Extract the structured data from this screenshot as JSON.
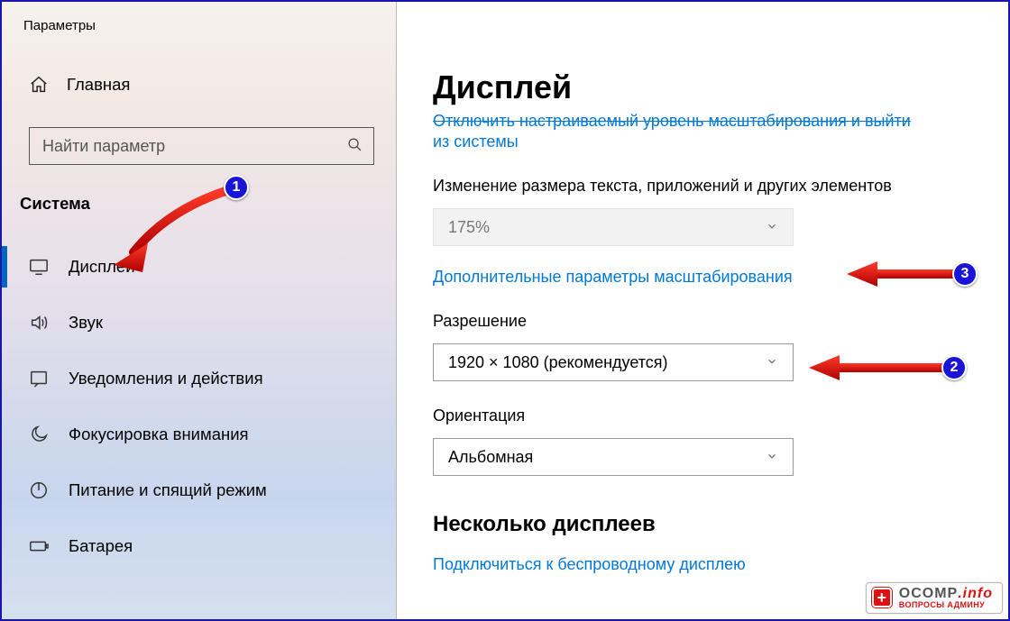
{
  "app_title": "Параметры",
  "home_label": "Главная",
  "search": {
    "placeholder": "Найти параметр"
  },
  "section": "Система",
  "nav": [
    {
      "id": "display",
      "label": "Дисплей",
      "icon": "monitor",
      "active": true
    },
    {
      "id": "sound",
      "label": "Звук",
      "icon": "sound",
      "active": false
    },
    {
      "id": "notifications",
      "label": "Уведомления и действия",
      "icon": "notif",
      "active": false
    },
    {
      "id": "focus",
      "label": "Фокусировка внимания",
      "icon": "moon",
      "active": false
    },
    {
      "id": "power",
      "label": "Питание и спящий режим",
      "icon": "power",
      "active": false
    },
    {
      "id": "battery",
      "label": "Батарея",
      "icon": "battery",
      "active": false
    }
  ],
  "page": {
    "title": "Дисплей",
    "cutoff_strike": "Отключить настраиваемый уровень масштабирования и выйти",
    "cutoff_line2": "из системы",
    "scale_label": "Изменение размера текста, приложений и других элементов",
    "scale_value": "175%",
    "scale_link": "Дополнительные параметры масштабирования",
    "resolution_label": "Разрешение",
    "resolution_value": "1920 × 1080 (рекомендуется)",
    "orientation_label": "Ориентация",
    "orientation_value": "Альбомная",
    "multi_title": "Несколько дисплеев",
    "wireless_link": "Подключиться к беспроводному дисплею"
  },
  "annotations": {
    "badge1": "1",
    "badge2": "2",
    "badge3": "3"
  },
  "watermark": {
    "brand": "OCOMP",
    "suffix": ".info",
    "subtitle": "ВОПРОСЫ АДМИНУ"
  }
}
